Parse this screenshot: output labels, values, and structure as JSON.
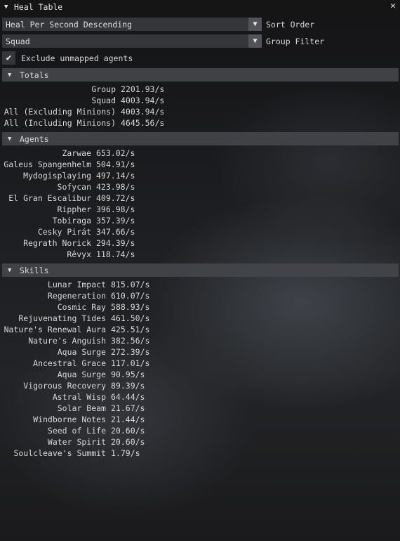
{
  "window": {
    "title": "Heal Table",
    "close_glyph": "✕"
  },
  "controls": {
    "sort_value": "Heal Per Second Descending",
    "sort_label": "Sort Order",
    "group_value": "Squad",
    "group_label": "Group Filter",
    "exclude_label": "Exclude unmapped agents",
    "exclude_checked": true,
    "dropdown_icon": "triangle-down-icon",
    "check_icon": "checkmark-icon"
  },
  "sections": {
    "totals_label": "Totals",
    "agents_label": "Agents",
    "skills_label": "Skills"
  },
  "totals": [
    {
      "name": "Group",
      "value": "2201.93/s"
    },
    {
      "name": "Squad",
      "value": "4003.94/s"
    },
    {
      "name": "All (Excluding Minions)",
      "value": "4003.94/s"
    },
    {
      "name": "All (Including Minions)",
      "value": "4645.56/s"
    }
  ],
  "agents": [
    {
      "name": "Zarwae",
      "value": "653.02/s"
    },
    {
      "name": "Galeus Spangenhelm",
      "value": "504.91/s"
    },
    {
      "name": "Mydogisplaying",
      "value": "497.14/s"
    },
    {
      "name": "Sofycan",
      "value": "423.98/s"
    },
    {
      "name": "El Gran Escalibur",
      "value": "409.72/s"
    },
    {
      "name": "RipphER",
      "value": "396.98/s"
    },
    {
      "name": "Tobiraga",
      "value": "357.39/s"
    },
    {
      "name": "Cesky Pirát",
      "value": "347.66/s"
    },
    {
      "name": "Regrath Norick",
      "value": "294.39/s"
    },
    {
      "name": "Rêvyx",
      "value": "118.74/s"
    }
  ],
  "skills": [
    {
      "name": "Lunar Impact",
      "value": "815.07/s"
    },
    {
      "name": "Regeneration",
      "value": "610.07/s"
    },
    {
      "name": "Cosmic Ray",
      "value": "588.93/s"
    },
    {
      "name": "Rejuvenating Tides",
      "value": "461.50/s"
    },
    {
      "name": "Nature's Renewal Aura",
      "value": "425.51/s"
    },
    {
      "name": "Nature's Anguish",
      "value": "382.56/s"
    },
    {
      "name": "Aqua Surge",
      "value": "272.39/s"
    },
    {
      "name": "Ancestral Grace",
      "value": "117.01/s"
    },
    {
      "name": "Aqua Surge",
      "value": "90.95/s"
    },
    {
      "name": "Vigorous Recovery",
      "value": "89.39/s"
    },
    {
      "name": "Astral Wisp",
      "value": "64.44/s"
    },
    {
      "name": "Solar Beam",
      "value": "21.67/s"
    },
    {
      "name": "Windborne Notes",
      "value": "21.44/s"
    },
    {
      "name": "Seed of Life",
      "value": "20.60/s"
    },
    {
      "name": "Water Spirit",
      "value": "20.60/s"
    },
    {
      "name": "Soulcleave's Summit",
      "value": "1.79/s"
    }
  ]
}
